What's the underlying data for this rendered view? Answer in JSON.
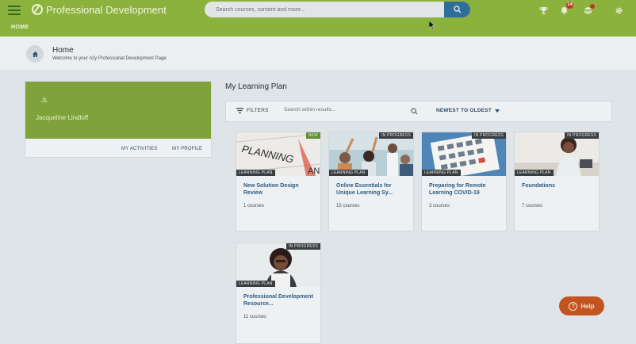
{
  "app": {
    "title": "Professional Development",
    "breadcrumb": "HOME"
  },
  "search": {
    "placeholder": "Search courses, content and more...",
    "icon": "search-icon"
  },
  "top_icons": {
    "trophy": "trophy-icon",
    "notifications": "bell-icon",
    "notification_count": "14",
    "messages": "message-icon",
    "settings": "gear-icon"
  },
  "page": {
    "title": "Home",
    "subtitle": "Welcome to your n2y Professional Development Page"
  },
  "profile": {
    "initials": "JL",
    "name": "Jacqueline Lindloff",
    "activities_label": "MY ACTIVITIES",
    "profile_label": "MY PROFILE"
  },
  "learning_plan": {
    "heading": "My Learning Plan",
    "filters_label": "FILTERS",
    "search_placeholder": "Search within results...",
    "sort_label": "NEWEST TO OLDEST",
    "cards": [
      {
        "title": "New Solution Design Review",
        "count": "1 courses",
        "type": "LEARNING PLAN",
        "status": "NEW"
      },
      {
        "title": "Online Essentials for Unique Learning Sy...",
        "count": "15 courses",
        "type": "LEARNING PLAN",
        "status": "IN PROGRESS"
      },
      {
        "title": "Preparing for Remote Learning COVID-19",
        "count": "3 courses",
        "type": "LEARNING PLAN",
        "status": "IN PROGRESS"
      },
      {
        "title": "Foundations",
        "count": "7 courses",
        "type": "LEARNING PLAN",
        "status": "IN PROGRESS"
      },
      {
        "title": "Professional Development Resource...",
        "count": "11 courses",
        "type": "LEARNING PLAN",
        "status": "IN PROGRESS"
      }
    ]
  },
  "help": {
    "label": "Help"
  },
  "colors": {
    "brand_green": "#8cb23e",
    "accent_blue": "#2f6e9a",
    "help_orange": "#c2541f"
  }
}
